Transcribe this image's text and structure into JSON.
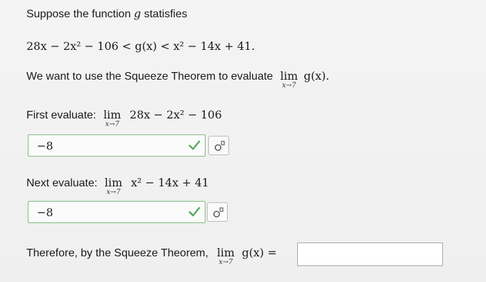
{
  "intro": {
    "text": "Suppose the function ",
    "var": "g",
    "text_after": " statisfies"
  },
  "inequality": {
    "left": "28x − 2x² − 106 <",
    "middle": "g(x)",
    "right": "< x² − 14x + 41."
  },
  "goal": {
    "text": "We want to use the Squeeze Theorem to evaluate",
    "lim": "lim",
    "sub": "x→7",
    "expr": "g(x)."
  },
  "first": {
    "label": "First evaluate:",
    "lim": "lim",
    "sub": "x→7",
    "expr": "28x − 2x² − 106",
    "answer": "−8"
  },
  "next": {
    "label": "Next evaluate:",
    "lim": "lim",
    "sub": "x→7",
    "expr": "x² − 14x + 41",
    "answer": "−8"
  },
  "conclusion": {
    "text": "Therefore, by the Squeeze Theorem,",
    "lim": "lim",
    "sub": "x→7",
    "expr": "g(x) =",
    "answer": ""
  },
  "icons": {
    "check": "check-icon",
    "keypad": "math-keypad-icon"
  },
  "colors": {
    "correct_border": "#7dbb7d",
    "check": "#5aa85a"
  }
}
